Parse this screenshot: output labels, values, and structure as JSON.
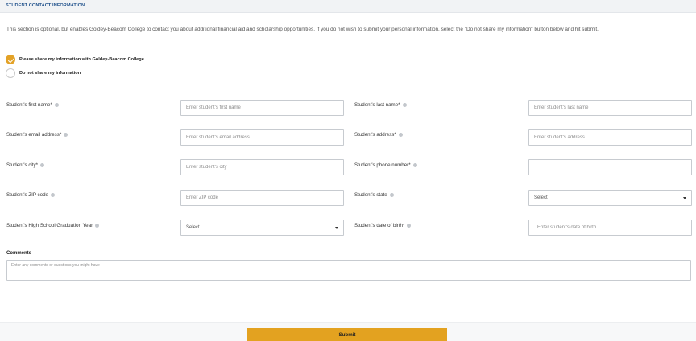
{
  "header": {
    "title": "STUDENT CONTACT INFORMATION"
  },
  "intro": "This section is optional, but enables Goldey-Beacom College to contact you about additional financial aid and scholarship opportunities. If you do not wish to submit your personal information, select the \"Do not share my information\" button below and hit submit.",
  "options": {
    "share": {
      "label": "Please share my information with Goldey-Beacom College",
      "selected": true
    },
    "no_share": {
      "label": "Do not share my information",
      "selected": false
    }
  },
  "fields": {
    "first_name": {
      "label": "Student's first name*",
      "placeholder": "Enter student's first name",
      "value": ""
    },
    "last_name": {
      "label": "Student's last name*",
      "placeholder": "Enter student's last name",
      "value": ""
    },
    "email": {
      "label": "Student's email address*",
      "placeholder": "Enter student's email address",
      "value": ""
    },
    "address": {
      "label": "Student's address*",
      "placeholder": "Enter student's address",
      "value": ""
    },
    "city": {
      "label": "Student's city*",
      "placeholder": "Enter student's city",
      "value": ""
    },
    "phone": {
      "label": "Student's phone number*",
      "placeholder": "",
      "value": ""
    },
    "zip": {
      "label": "Student's ZIP code",
      "placeholder": "Enter ZIP code",
      "value": ""
    },
    "state": {
      "label": "Student's state",
      "selected": "Select"
    },
    "grad_year": {
      "label": "Student's High School Graduation Year",
      "selected": "Select"
    },
    "dob": {
      "label": "Student's date of birth*",
      "placeholder": "Enter student's date of birth",
      "value": ""
    }
  },
  "comments": {
    "label": "Comments",
    "placeholder": "Enter any comments or questions you might have"
  },
  "submit": {
    "label": "Submit"
  },
  "colors": {
    "accent": "#e3a220",
    "header_text": "#1d4f8a"
  },
  "icons": {
    "info": "info-icon",
    "caret": "caret-down-icon",
    "check": "check-icon"
  }
}
